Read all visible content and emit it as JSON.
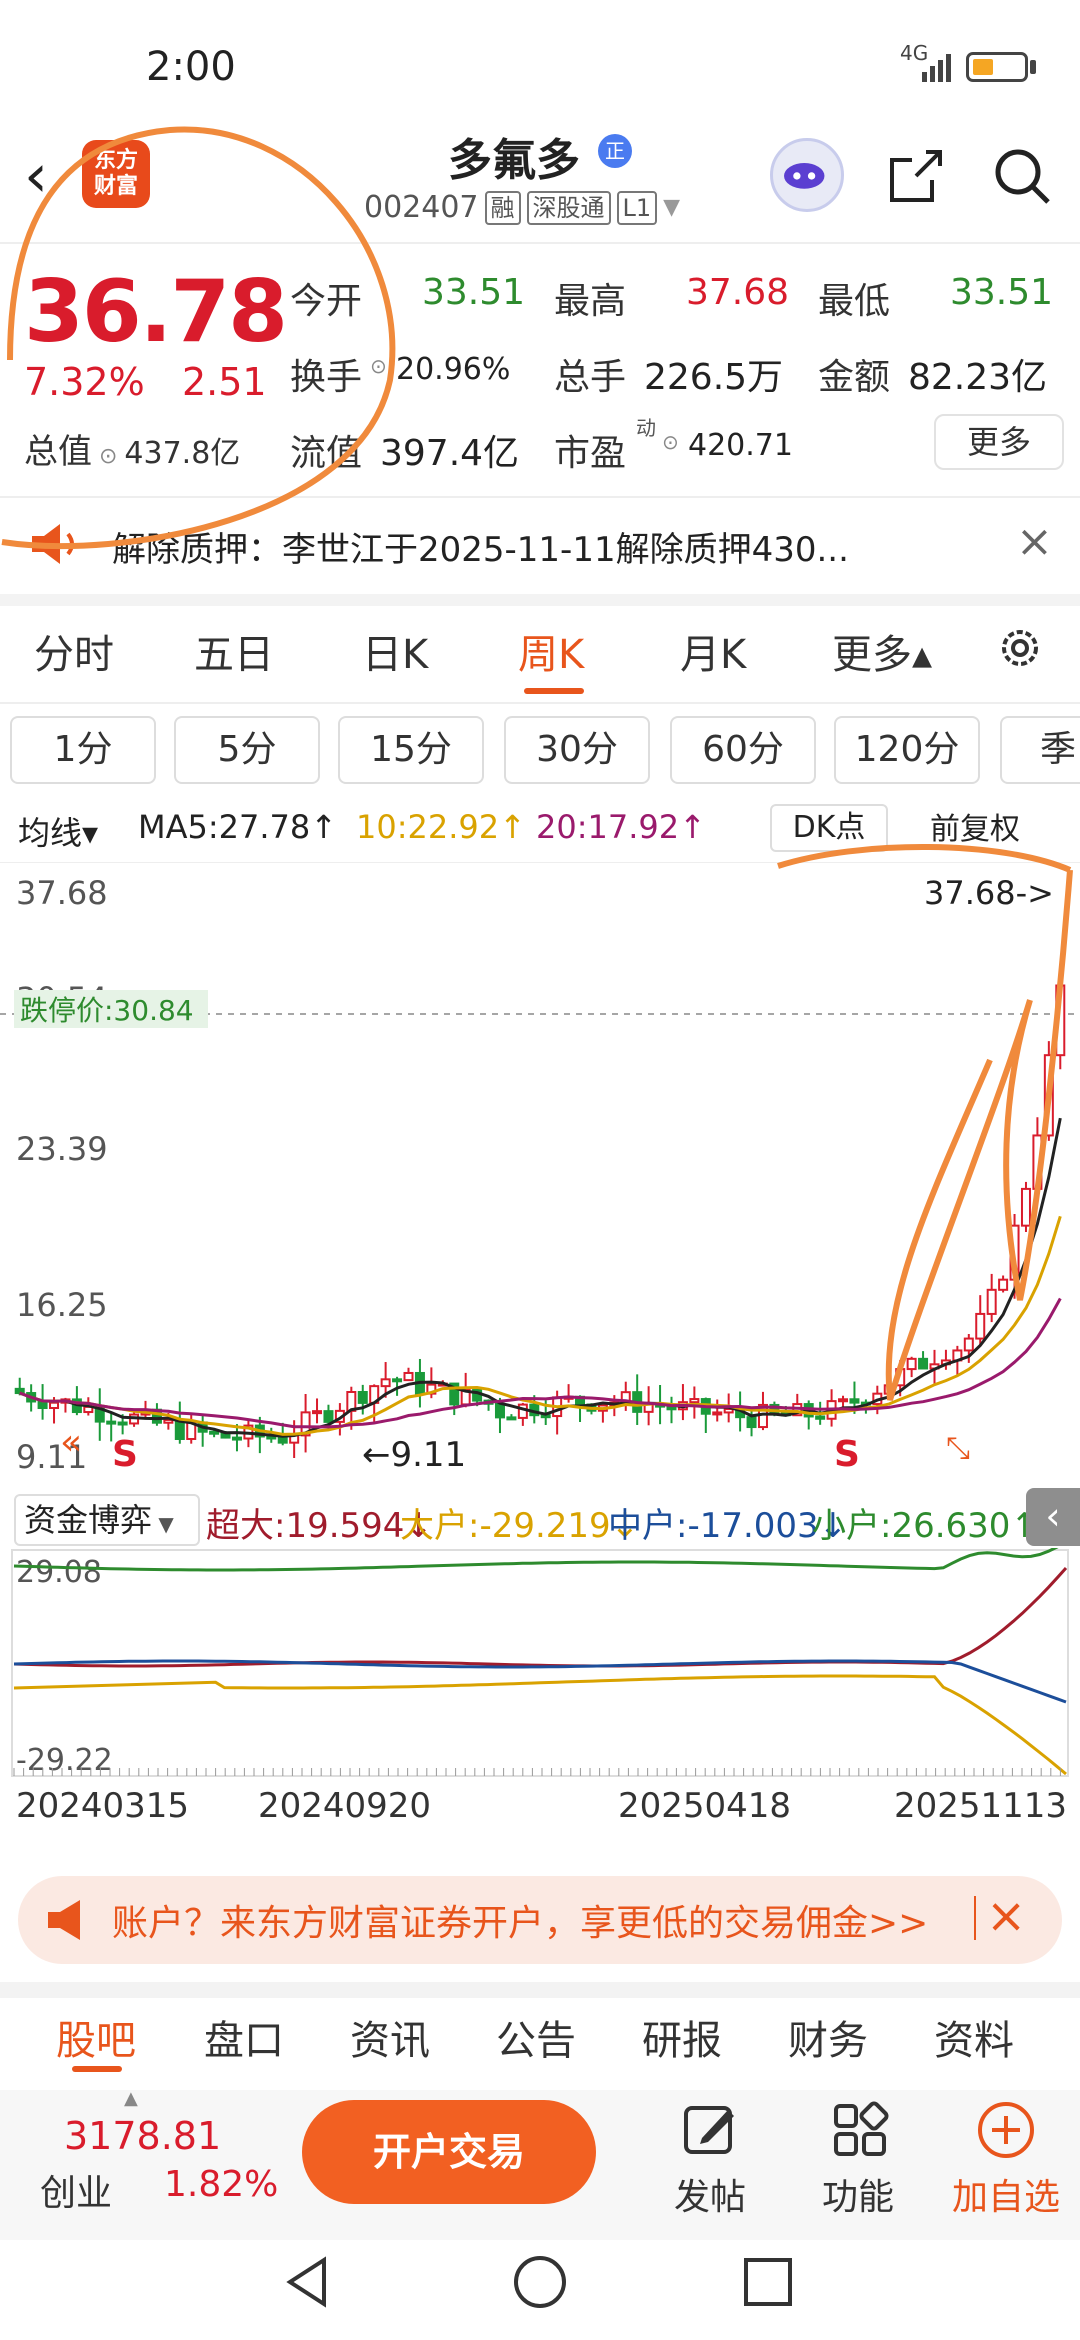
{
  "status": {
    "time": "2:00",
    "network": "4G"
  },
  "header": {
    "name": "多氟多",
    "badge": "正",
    "code": "002407",
    "tags": [
      "融",
      "深股通",
      "L1"
    ],
    "logo_line1": "东方",
    "logo_line2": "财富"
  },
  "quote": {
    "price": "36.78",
    "pct": "7.32%",
    "change": "2.51",
    "rows": [
      [
        {
          "label": "今开",
          "value": "33.51",
          "color": "green"
        },
        {
          "label": "最高",
          "value": "37.68",
          "color": "red"
        },
        {
          "label": "最低",
          "value": "33.51",
          "color": "green"
        }
      ],
      [
        {
          "label": "换手",
          "value": "20.96%",
          "color": "dark"
        },
        {
          "label": "总手",
          "value": "226.5万",
          "color": "dark"
        },
        {
          "label": "金额",
          "value": "82.23亿",
          "color": "dark"
        }
      ],
      [
        {
          "label": "流值",
          "value": "397.4亿",
          "color": "dark"
        },
        {
          "label": "市盈",
          "value": "420.71",
          "color": "dark"
        }
      ]
    ],
    "total_cap_label": "总值",
    "total_cap": "437.8亿",
    "pe_sup": "动",
    "more": "更多"
  },
  "notice": {
    "text": "解除质押：李世江于2025-11-11解除质押430..."
  },
  "period_tabs": [
    "分时",
    "五日",
    "日K",
    "周K",
    "月K",
    "更多▴"
  ],
  "active_period": "周K",
  "intervals": [
    "1分",
    "5分",
    "15分",
    "30分",
    "60分",
    "120分",
    "季"
  ],
  "ma": {
    "label": "均线▾",
    "ma5": "MA5:27.78↑",
    "ma10": "10:22.92↑",
    "ma20": "20:17.92↑",
    "dk": "DK点",
    "adjust": "前复权"
  },
  "chart_data": {
    "type": "candlestick",
    "y_ticks": [
      "37.68",
      "30.54",
      "23.39",
      "16.25",
      "9.11"
    ],
    "ylim": [
      9.11,
      37.68
    ],
    "limit_down": {
      "label": "跌停价:30.84",
      "value": 30.84
    },
    "high_marker": "37.68->",
    "low_marker": "←9.11",
    "signals": [
      "S",
      "S"
    ],
    "ma_colors": {
      "ma5": "#222222",
      "ma10": "#d9a200",
      "ma20": "#9a1a6c"
    },
    "up_color": "#d91c2c",
    "down_color": "#1a9a3a"
  },
  "funds": {
    "selector": "资金博弈",
    "super": "超大:19.594↓",
    "large": "大户:-29.219↓",
    "medium": "中户:-17.003↓",
    "small": "小户:26.630↑",
    "y_max": "29.08",
    "y_min": "-29.22",
    "series_colors": {
      "super": "#a01c2c",
      "large": "#d9a200",
      "medium": "#1c4e9a",
      "small": "#2e8b2e"
    }
  },
  "dates": [
    "20240315",
    "20240920",
    "20250418",
    "20251113"
  ],
  "ad": {
    "text": "账户？来东方财富证券开户，享更低的交易佣金>>"
  },
  "content_tabs": [
    "股吧",
    "盘口",
    "资讯",
    "公告",
    "研报",
    "财务",
    "资料"
  ],
  "active_content_tab": "股吧",
  "bottom": {
    "index_value": "3178.81",
    "index_name": "创业",
    "index_pct": "1.82%",
    "trade": "开户交易",
    "post": "发帖",
    "function": "功能",
    "watch": "加自选"
  }
}
